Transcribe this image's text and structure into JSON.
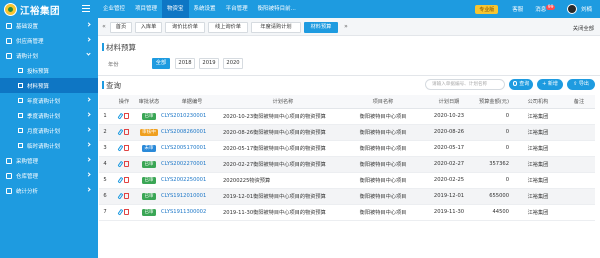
{
  "header": {
    "brand": "江裕集团",
    "nav": [
      "企业管控",
      "项目管理",
      "物资宝",
      "系统设置",
      "平台管理",
      "衡阳被特目前..."
    ],
    "active_nav_index": 2,
    "pro_badge": "专业版",
    "service": "客服",
    "messages": "消息",
    "messages_count": "99",
    "user": "刘楠"
  },
  "sidebar": {
    "items": [
      {
        "label": "基础设置",
        "type": "group"
      },
      {
        "label": "供应商管理",
        "type": "group"
      },
      {
        "label": "请购计划",
        "type": "group",
        "open": true
      },
      {
        "label": "投标预算",
        "type": "sub"
      },
      {
        "label": "材料预算",
        "type": "sub",
        "active": true
      },
      {
        "label": "年度请购计划",
        "type": "sub"
      },
      {
        "label": "季度请购计划",
        "type": "sub"
      },
      {
        "label": "月度请购计划",
        "type": "sub"
      },
      {
        "label": "临时请购计划",
        "type": "sub"
      },
      {
        "label": "采购管理",
        "type": "group"
      },
      {
        "label": "仓库管理",
        "type": "group"
      },
      {
        "label": "统计分析",
        "type": "group"
      }
    ]
  },
  "tabs": {
    "items": [
      "首页",
      "入库单",
      "询价比价单",
      "线上询价单",
      "年度请购计划",
      "材料预算"
    ],
    "active_index": 5,
    "close_all": "关闭全部"
  },
  "budget_panel": {
    "title": "材料预算",
    "year_label": "年份",
    "years": [
      "全部",
      "2018",
      "2019",
      "2020"
    ],
    "active_year_index": 0
  },
  "query": {
    "title": "查询",
    "search_placeholder": "请输入单据编号、计划名称",
    "search_button": "查询",
    "add_button": "新增",
    "export_button": "导出"
  },
  "table": {
    "columns": [
      "",
      "操作",
      "审批状态",
      "单据编号",
      "计划名称",
      "项目名称",
      "计划日期",
      "预算金额(元)",
      "公司机构",
      "备注"
    ],
    "rows": [
      {
        "no": "1",
        "status": "已审",
        "status_color": "g",
        "code": "CLYS2010230001",
        "plan": "2020-10-23衡阳被特目中心项目的物资预算",
        "project": "衡阳被特目中心项目",
        "date": "2020-10-23",
        "amount": "0",
        "org": "江裕集团",
        "note": ""
      },
      {
        "no": "2",
        "status": "审核中",
        "status_color": "o",
        "code": "CLYS2008260001",
        "plan": "2020-08-26衡阳被特目中心项目的物资预算",
        "project": "衡阳被特目中心项目",
        "date": "2020-08-26",
        "amount": "0",
        "org": "江裕集团",
        "note": ""
      },
      {
        "no": "3",
        "status": "未审",
        "status_color": "b",
        "code": "CLYS2005170001",
        "plan": "2020-05-17衡阳被特目中心项目的物资预算",
        "project": "衡阳被特目中心项目",
        "date": "2020-05-17",
        "amount": "0",
        "org": "江裕集团",
        "note": ""
      },
      {
        "no": "4",
        "status": "已审",
        "status_color": "g",
        "code": "CLYS2002270001",
        "plan": "2020-02-27衡阳被特目中心项目的物资预算",
        "project": "衡阳被特目中心项目",
        "date": "2020-02-27",
        "amount": "357362",
        "org": "江裕集团",
        "note": ""
      },
      {
        "no": "5",
        "status": "已审",
        "status_color": "g",
        "code": "CLYS2002250001",
        "plan": "20200225物资预算",
        "project": "衡阳被特目中心项目",
        "date": "2020-02-25",
        "amount": "0",
        "org": "江裕集团",
        "note": ""
      },
      {
        "no": "6",
        "status": "已审",
        "status_color": "g",
        "code": "CLYS1912010001",
        "plan": "2019-12-01衡阳被特目中心项目的物资预算",
        "project": "衡阳被特目中心项目",
        "date": "2019-12-01",
        "amount": "655000",
        "org": "江裕集团",
        "note": ""
      },
      {
        "no": "7",
        "status": "已审",
        "status_color": "g",
        "code": "CLYS1911300002",
        "plan": "2019-11-30衡阳被特目中心项目的物资预算",
        "project": "衡阳被特目中心项目",
        "date": "2019-11-30",
        "amount": "44500",
        "org": "江裕集团",
        "note": ""
      }
    ]
  },
  "colors": {
    "primary": "#1e9be0",
    "dark_primary": "#0e76c4",
    "approved": "#3aa655",
    "reviewing": "#f0a020",
    "unreviewed": "#2b8ad9"
  }
}
